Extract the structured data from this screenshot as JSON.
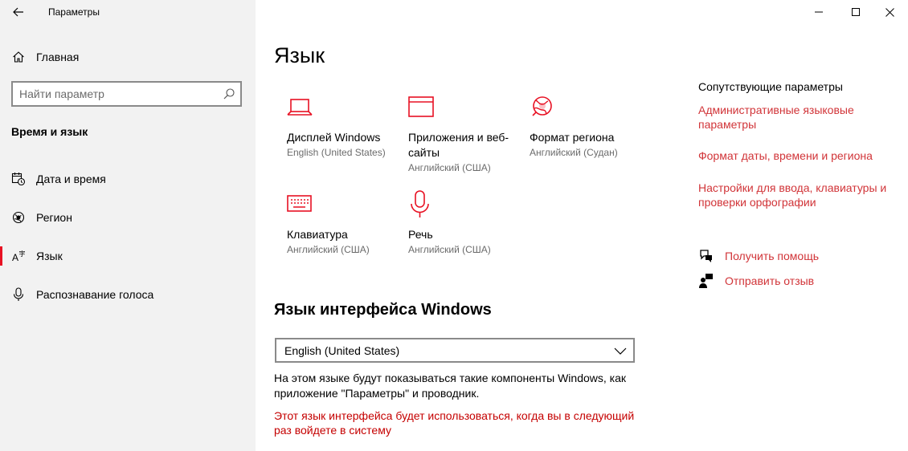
{
  "window": {
    "app_title": "Параметры",
    "controls": [
      "minimize-icon",
      "maximize-icon",
      "close-icon"
    ]
  },
  "colors": {
    "accent": "#e81123",
    "link": "#d13438",
    "warning": "#c50000",
    "sidebar_bg": "#f2f2f2"
  },
  "sidebar": {
    "home_label": "Главная",
    "search_placeholder": "Найти параметр",
    "section_title": "Время и язык",
    "items": [
      {
        "label": "Дата и время",
        "icon": "date-time-icon"
      },
      {
        "label": "Регион",
        "icon": "region-icon"
      },
      {
        "label": "Язык",
        "icon": "language-icon",
        "active": true
      },
      {
        "label": "Распознавание голоса",
        "icon": "microphone-icon"
      }
    ]
  },
  "main": {
    "title": "Язык",
    "tiles": [
      {
        "title": "Дисплей Windows",
        "subtitle": "English (United States)",
        "icon": "laptop-icon"
      },
      {
        "title": "Приложения и веб-сайты",
        "subtitle": "Английский (США)",
        "icon": "browser-window-icon"
      },
      {
        "title": "Формат региона",
        "subtitle": "Английский (Судан)",
        "icon": "globe-icon"
      },
      {
        "title": "Клавиатура",
        "subtitle": "Английский (США)",
        "icon": "keyboard-icon"
      },
      {
        "title": "Речь",
        "subtitle": "Английский (США)",
        "icon": "microphone-icon"
      }
    ],
    "display_language_heading": "Язык интерфейса Windows",
    "display_language_value": "English (United States)",
    "display_language_description": "На этом языке будут показываться такие компоненты Windows, как приложение \"Параметры\" и проводник.",
    "warning": "Этот язык интерфейса будет использоваться, когда вы в следующий раз войдете в систему"
  },
  "related": {
    "title": "Сопутствующие параметры",
    "links": [
      "Административные языковые параметры",
      "Формат даты, времени и региона",
      "Настройки для ввода, клавиатуры и проверки орфографии"
    ],
    "help_label": "Получить помощь",
    "feedback_label": "Отправить отзыв"
  }
}
